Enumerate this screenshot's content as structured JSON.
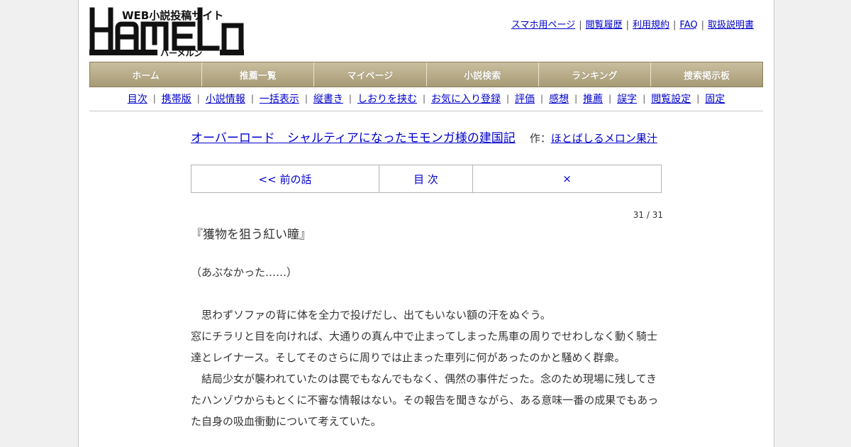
{
  "site": {
    "logo_main": "HAMELN",
    "logo_top": "WEB小説投稿サイト",
    "logo_kana": "ハーメルン"
  },
  "top_links": [
    "スマホ用ページ",
    "閲覧履歴",
    "利用規約",
    "FAQ",
    "取扱説明書"
  ],
  "main_nav": [
    "ホーム",
    "推薦一覧",
    "マイページ",
    "小説検索",
    "ランキング",
    "捜索掲示板"
  ],
  "sub_nav": [
    "目次",
    "携帯版",
    "小説情報",
    "一括表示",
    "縦書き",
    "しおりを挟む",
    "お気に入り登録",
    "評価",
    "感想",
    "推薦",
    "誤字",
    "閲覧設定",
    "固定"
  ],
  "novel": {
    "title": "オーバーロード　シャルティアになったモモンガ様の建国記",
    "author_prefix": "作：",
    "author": "ほとばしるメロン果汁"
  },
  "chapter_nav": {
    "prev": "<< 前の話",
    "toc": "目 次",
    "next": "×"
  },
  "page_count": "31 / 31",
  "chapter_title": "『獲物を狙う紅い瞳』",
  "body": [
    "（あぶなかった……）",
    "",
    "　思わずソファの背に体を全力で投げだし、出てもいない額の汗をぬぐう。",
    "窓にチラリと目を向ければ、大通りの真ん中で止まってしまった馬車の周りでせわしなく動く騎士達とレイナース。そしてそのさらに周りでは止まった車列に何があったのかと騒めく群衆。",
    "　結局少女が襲われていたのは罠でもなんでもなく、偶然の事件だった。念のため現場に残してきたハンゾウからもとくに不審な情報はない。その報告を聞きながら、ある意味一番の成果でもあった自身の吸血衝動について考えていた。"
  ]
}
